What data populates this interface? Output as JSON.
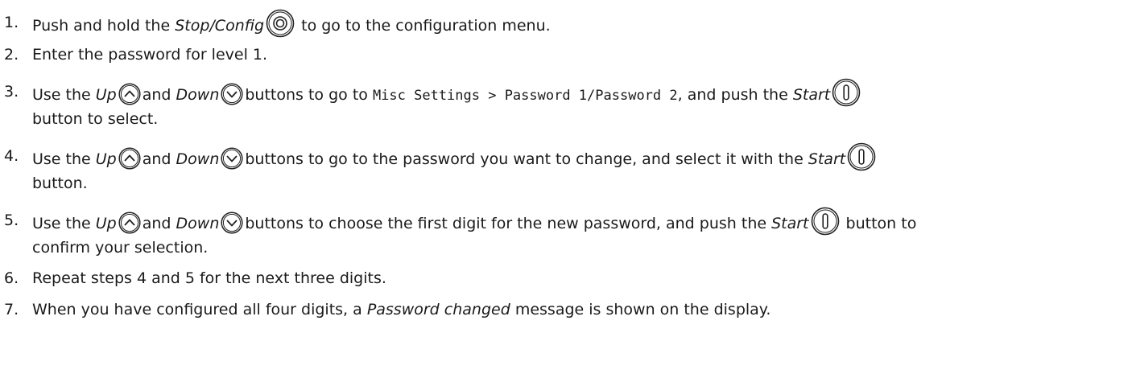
{
  "steps": [
    {
      "num": "1.",
      "parts": [
        {
          "t": "Push and hold the "
        },
        {
          "t": "Stop/Config",
          "style": "i"
        },
        {
          "icon": "stop-config-icon"
        },
        {
          "t": " to go to the configuration menu."
        }
      ]
    },
    {
      "num": "2.",
      "parts": [
        {
          "t": "Enter the password for level 1."
        }
      ]
    },
    {
      "num": "3.",
      "parts": [
        {
          "t": "Use the "
        },
        {
          "t": "Up",
          "style": "i"
        },
        {
          "icon": "up-arrow-icon"
        },
        {
          "t": "and "
        },
        {
          "t": "Down",
          "style": "i"
        },
        {
          "icon": "down-arrow-icon"
        },
        {
          "t": "buttons to go to "
        },
        {
          "t": "Misc Settings > Password 1/Password 2",
          "style": "mono"
        },
        {
          "t": ", and push the "
        },
        {
          "t": "Start",
          "style": "i"
        },
        {
          "icon": "start-icon"
        },
        {
          "br": true
        },
        {
          "t": "button to select."
        }
      ]
    },
    {
      "num": "4.",
      "parts": [
        {
          "t": "Use the "
        },
        {
          "t": "Up",
          "style": "i"
        },
        {
          "icon": "up-arrow-icon"
        },
        {
          "t": "and "
        },
        {
          "t": "Down",
          "style": "i"
        },
        {
          "icon": "down-arrow-icon"
        },
        {
          "t": "buttons to go to the password you want to change, and select it with the "
        },
        {
          "t": "Start",
          "style": "i"
        },
        {
          "icon": "start-icon"
        },
        {
          "br": true
        },
        {
          "t": "button."
        }
      ]
    },
    {
      "num": "5.",
      "parts": [
        {
          "t": "Use the "
        },
        {
          "t": "Up",
          "style": "i"
        },
        {
          "icon": "up-arrow-icon"
        },
        {
          "t": "and "
        },
        {
          "t": "Down",
          "style": "i"
        },
        {
          "icon": "down-arrow-icon"
        },
        {
          "t": "buttons to choose the first digit for the new password, and push the "
        },
        {
          "t": "Start",
          "style": "i"
        },
        {
          "icon": "start-icon"
        },
        {
          "t": " button to"
        },
        {
          "br": true
        },
        {
          "t": "confirm your selection."
        }
      ]
    },
    {
      "num": "6.",
      "parts": [
        {
          "t": "Repeat steps 4 and 5 for the next three digits."
        }
      ]
    },
    {
      "num": "7.",
      "parts": [
        {
          "t": "When you have configured all four digits, a "
        },
        {
          "t": "Password changed",
          "style": "i"
        },
        {
          "t": " message is shown on the display."
        }
      ]
    }
  ]
}
